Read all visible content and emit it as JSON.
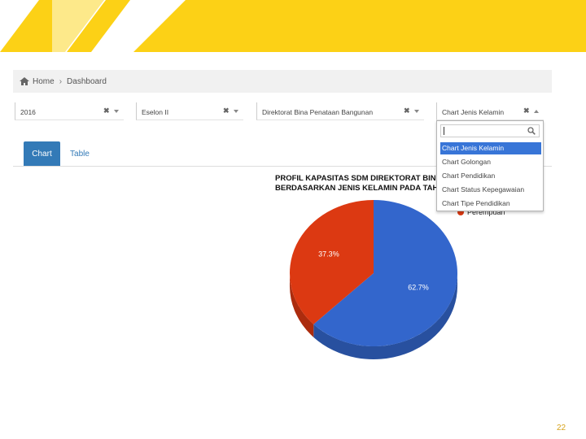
{
  "breadcrumb": {
    "home": "Home",
    "separator": "›",
    "current": "Dashboard"
  },
  "filters": [
    {
      "value": "2016"
    },
    {
      "value": "Eselon II"
    },
    {
      "value": "Direktorat Bina Penataan Bangunan"
    },
    {
      "value": "Chart Jenis Kelamin"
    }
  ],
  "tabs": [
    {
      "label": "Chart",
      "active": true
    },
    {
      "label": "Table",
      "active": false
    }
  ],
  "chart": {
    "title_line1": "PROFIL KAPASITAS SDM DIREKTORAT BIN",
    "title_line2": "BERDASARKAN JENIS KELAMIN PADA TAH",
    "legend_visible": "Perempuan",
    "colors": {
      "laki": "#3366cc",
      "perempuan": "#dc3912"
    }
  },
  "chart_data": {
    "type": "pie",
    "slices": [
      {
        "label": "",
        "value": 62.7,
        "color": "#3366cc"
      },
      {
        "label": "Perempuan",
        "value": 37.3,
        "color": "#dc3912"
      }
    ],
    "data_labels": [
      "62.7%",
      "37.3%"
    ]
  },
  "dropdown": {
    "options": [
      "Chart Jenis Kelamin",
      "Chart Golongan",
      "Chart Pendidikan",
      "Chart Status Kepegawaian",
      "Chart Tipe Pendidikan"
    ],
    "selected_index": 0
  },
  "page_number": "22",
  "brand_colors": {
    "yellow": "#fcd116",
    "light_yellow": "#fde98a"
  }
}
